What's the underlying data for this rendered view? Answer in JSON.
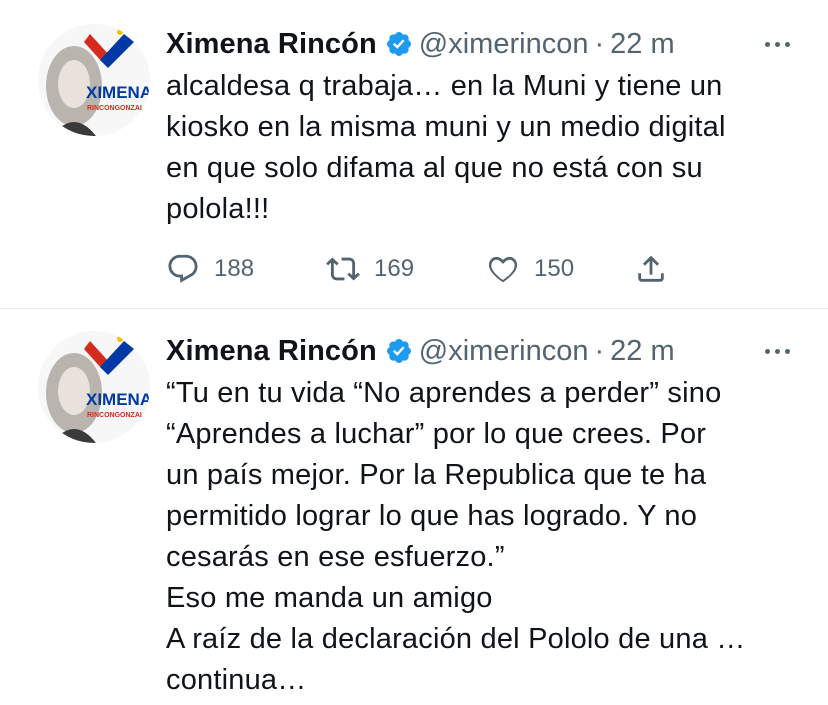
{
  "tweets": [
    {
      "avatar": {
        "label": "XIMENA",
        "sublabel": "RINCONGONZAL"
      },
      "name": "Ximena Rincón",
      "handle": "@ximerincon",
      "separator": "·",
      "time": "22 m",
      "text": "alcaldesa q trabaja… en la Muni y tiene un\nkiosko en la misma muni y un medio digital\nen que solo difama al que no está con su\npolola!!!",
      "replies": "188",
      "retweets": "169",
      "likes": "150"
    },
    {
      "avatar": {
        "label": "XIMENA",
        "sublabel": "RINCONGONZAL"
      },
      "name": "Ximena Rincón",
      "handle": "@ximerincon",
      "separator": "·",
      "time": "22 m",
      "text": "“Tu en tu vida “No aprendes a perder” sino\n“Aprendes a luchar” por lo que crees. Por\nun país mejor. Por la Republica que te ha\npermitido lograr lo que has logrado. Y no\ncesarás en ese esfuerzo.”\nEso me manda un amigo\nA raíz de la declaración del Pololo de una …\ncontinua…"
    }
  ],
  "colors": {
    "verified": "#1d9bf0",
    "muted": "#536471",
    "text": "#0f1419",
    "divider": "#e6ecf0"
  },
  "icons": [
    "verified-badge-icon",
    "more-icon",
    "reply-icon",
    "retweet-icon",
    "like-icon",
    "share-icon"
  ]
}
